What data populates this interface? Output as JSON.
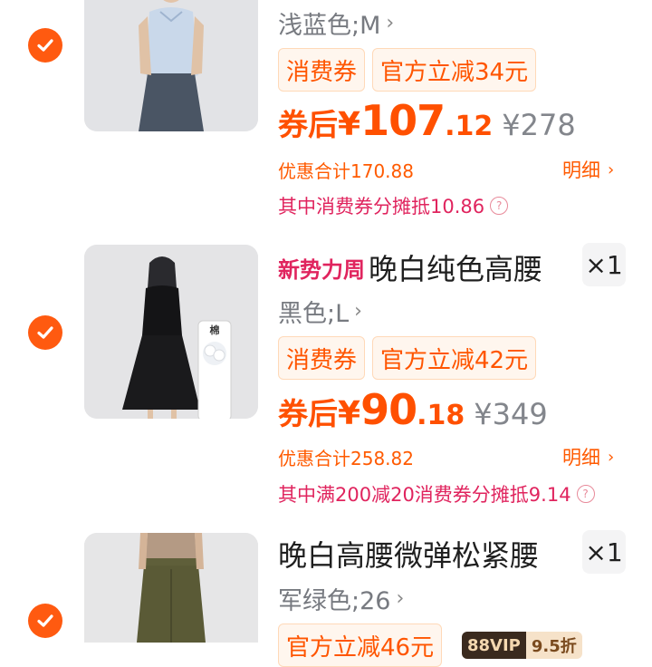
{
  "items": [
    {
      "variant": "浅蓝色;M",
      "tags": [
        "消费券",
        "官方立减34元"
      ],
      "price_label": "券后",
      "currency": "¥",
      "price_int": "107",
      "price_dec": ".12",
      "original_price": "¥278",
      "discount_total": "优惠合计170.88",
      "detail_label": "明细",
      "coupon_share": "其中消费券分摊抵10.86"
    },
    {
      "title_tag": "新势力周",
      "title": "晚白纯色高腰",
      "quantity": "×1",
      "variant": "黑色;L",
      "tags": [
        "消费券",
        "官方立减42元"
      ],
      "price_label": "券后",
      "currency": "¥",
      "price_int": "90",
      "price_dec": ".18",
      "original_price": "¥349",
      "discount_total": "优惠合计258.82",
      "detail_label": "明细",
      "coupon_share": "其中满200减20消费券分摊抵9.14",
      "thumb_badge": "棉"
    },
    {
      "title": "晚白高腰微弹松紧腰",
      "quantity": "×1",
      "variant": "军绿色;26",
      "tags": [
        "官方立减46元"
      ],
      "vip_badge_a": "88VIP",
      "vip_badge_b": "9.5折"
    }
  ],
  "colors": {
    "accent": "#ff5000",
    "check": "#ff5a10",
    "coupon_share": "#e0245e"
  }
}
